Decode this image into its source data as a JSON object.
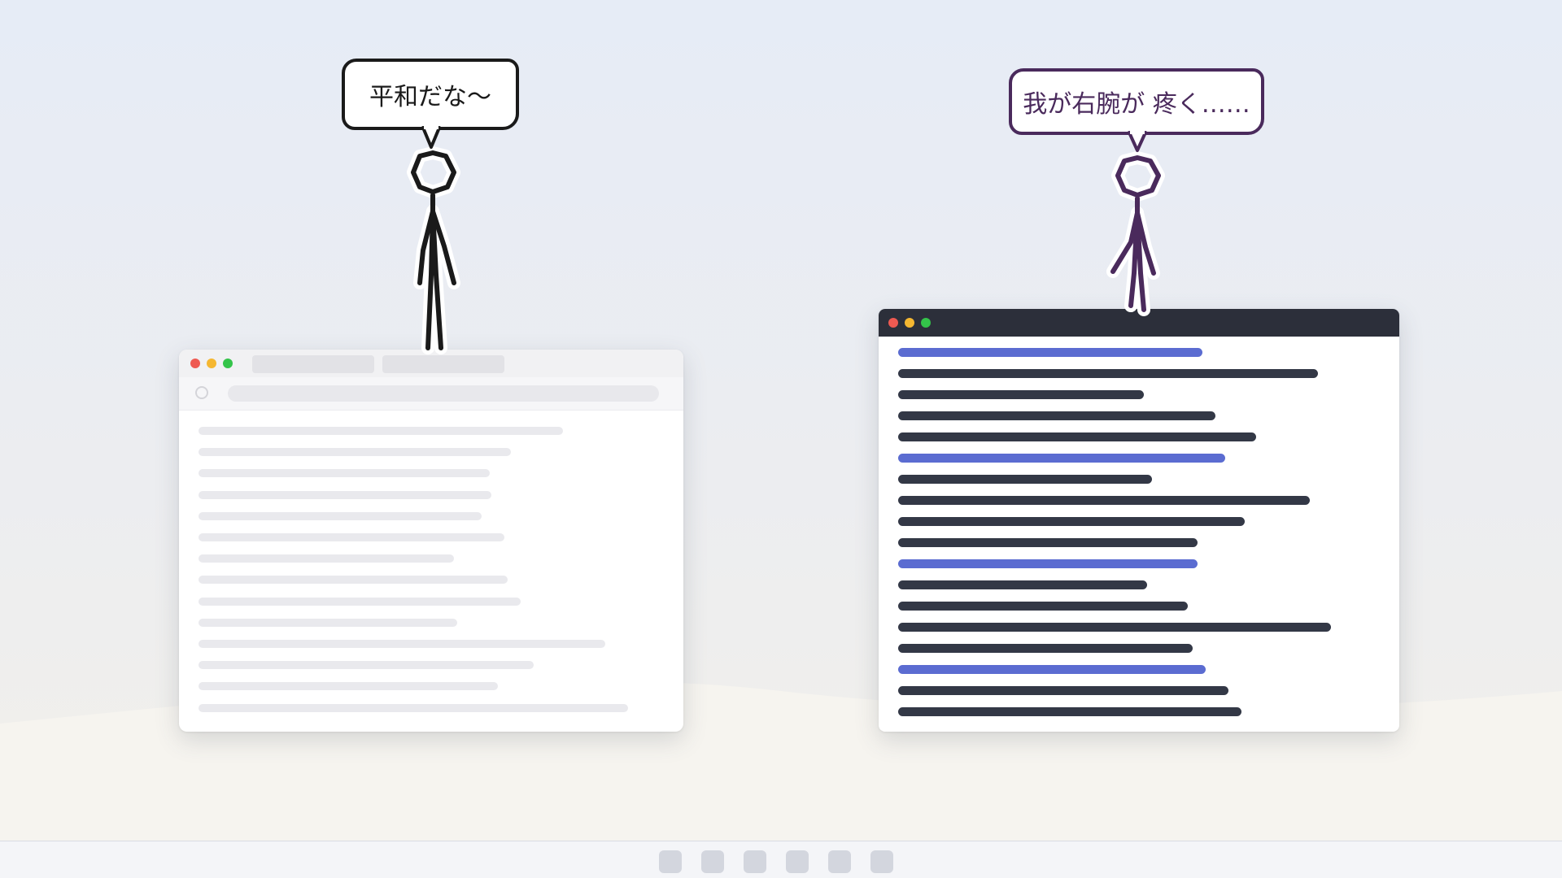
{
  "scene": {
    "left_character": {
      "speech": "平和だな〜",
      "color": "#1a1a1a"
    },
    "right_character": {
      "speech": "我が右腕が 疼く……",
      "color": "#4a2a5c"
    }
  },
  "windows": {
    "left": {
      "type": "browser",
      "traffic_lights": [
        "#ee5a52",
        "#f5b731",
        "#34c44a"
      ],
      "tab_count": 2
    },
    "right": {
      "type": "code-editor",
      "traffic_lights": [
        "#ee5a52",
        "#f5b731",
        "#34c44a"
      ],
      "titlebar_color": "#2c2f3a",
      "line_colors": {
        "keyword": "#5b6cd1",
        "code": "#333846"
      }
    }
  },
  "dock": {
    "item_count": 6
  }
}
